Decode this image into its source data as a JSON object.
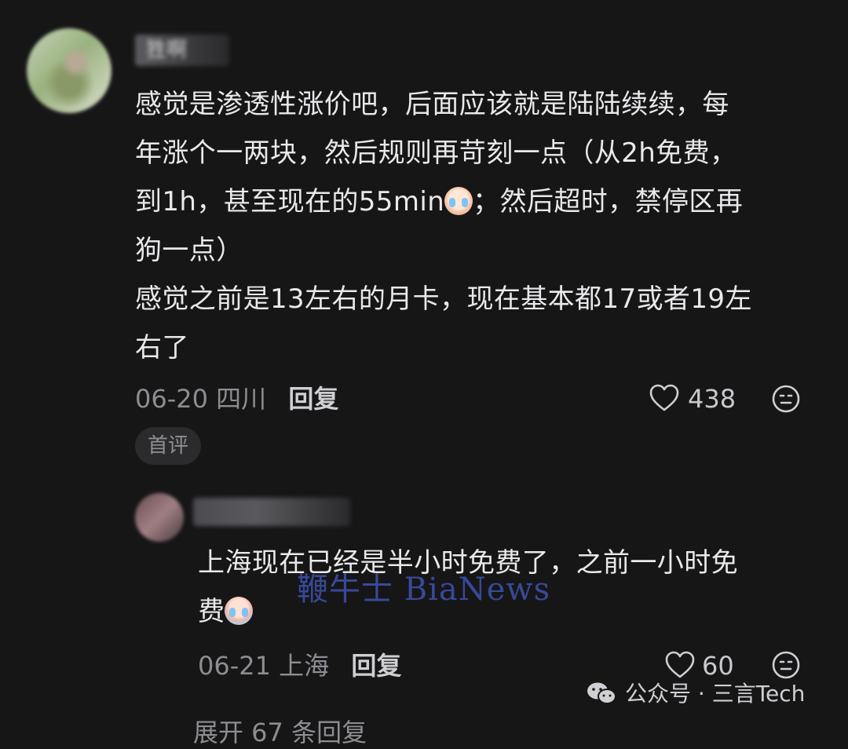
{
  "comment1": {
    "username": "狌啊",
    "lines": [
      "感觉是渗透性涨价吧，后面应该就是陆陆续续，每",
      "年涨个一两块，然后规则再苛刻一点（从2h免费，",
      "到1h，甚至现在的55min",
      "；然后超时，禁停区再",
      "狗一点）",
      "感觉之前是13左右的月卡，现在基本都17或者19左",
      "右了"
    ],
    "date": "06-20",
    "location": "四川",
    "reply_label": "回复",
    "likes": "438",
    "badge": "首评"
  },
  "comment2": {
    "lines": [
      "上海现在已经是半小时免费了，之前一小时免",
      "费"
    ],
    "date": "06-21",
    "location": "上海",
    "reply_label": "回复",
    "likes": "60"
  },
  "watermark": "鞭牛士 BiaNews",
  "brand": {
    "prefix": "公众号 · ",
    "name": "三言Tech"
  },
  "cutoff_text": "展开 67 条回复",
  "icons": [
    "heart-icon",
    "emoji-reaction-icon",
    "wechat-icon",
    "crying-emoji-icon"
  ],
  "colors": {
    "background": "#161617",
    "text": "#e9e9eb",
    "meta": "#8d8d92",
    "watermark": "#3c4fa8"
  }
}
